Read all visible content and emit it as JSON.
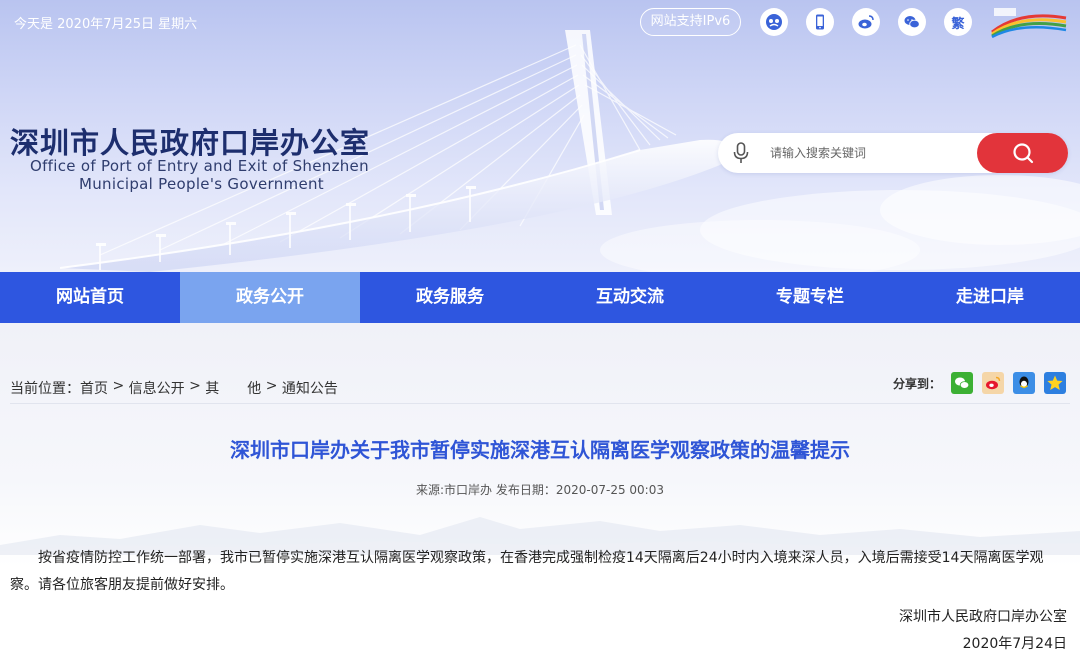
{
  "topbar": {
    "date_text": "今天是 2020年7月25日 星期六",
    "ipv6_label": "网站支持IPv6",
    "icons": [
      "accessibility-icon",
      "mobile-icon",
      "weibo-icon",
      "wechat-icon"
    ],
    "traditional_label": "繁"
  },
  "header": {
    "title": "深圳市人民政府口岸办公室",
    "subtitle_line1": "Office of Port of Entry and Exit of Shenzhen",
    "subtitle_line2": "Municipal People's Government"
  },
  "search": {
    "placeholder": "请输入搜索关键词"
  },
  "nav": {
    "items": [
      {
        "label": "网站首页"
      },
      {
        "label": "政务公开"
      },
      {
        "label": "政务服务"
      },
      {
        "label": "互动交流"
      },
      {
        "label": "专题专栏"
      },
      {
        "label": "走进口岸"
      }
    ]
  },
  "breadcrumb": {
    "prefix": "当前位置：",
    "items": [
      "首页",
      "信息公开",
      "其　　他",
      "通知公告"
    ],
    "separator": " > "
  },
  "share": {
    "label": "分享到：",
    "targets": [
      "wechat-icon",
      "weibo-icon",
      "qq-icon",
      "qzone-icon"
    ]
  },
  "article": {
    "title": "深圳市口岸办关于我市暂停实施深港互认隔离医学观察政策的温馨提示",
    "meta": "来源:市口岸办 发布日期：2020-07-25 00:03",
    "body": "按省疫情防控工作统一部署，我市已暂停实施深港互认隔离医学观察政策，在香港完成强制检疫14天隔离后24小时内入境来深人员，入境后需接受14天隔离医学观察。请各位旅客朋友提前做好安排。",
    "signature": "深圳市人民政府口岸办公室",
    "date": "2020年7月24日"
  },
  "colors": {
    "nav_bg": "#2e56e0",
    "nav_active": "#7aa4ef",
    "title_blue": "#2f55d6",
    "search_red": "#e2343b"
  }
}
